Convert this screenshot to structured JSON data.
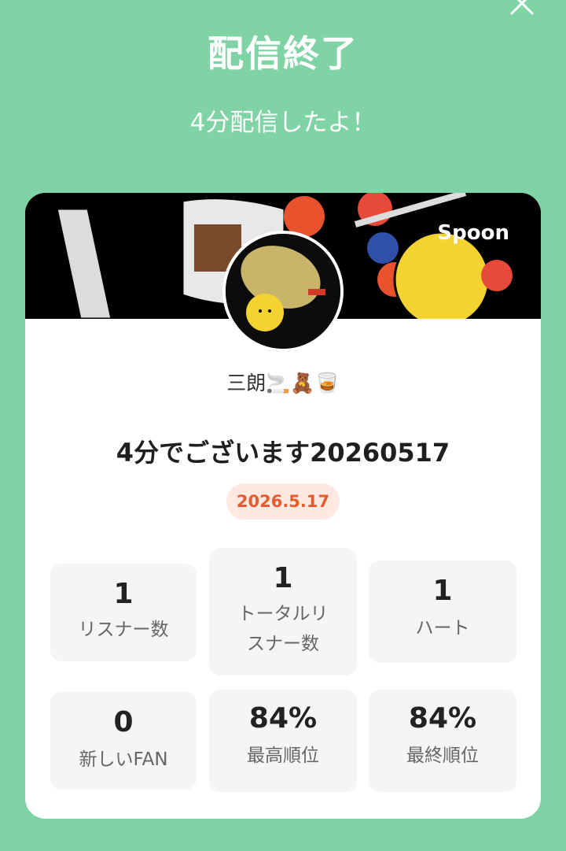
{
  "header": {
    "title": "配信終了",
    "subtitle": "4分配信したよ！"
  },
  "card": {
    "brand": "Spoon",
    "username": "三朗🚬🧸🥃",
    "stream_title": "4分でございます20260517",
    "date": "2026.5.17"
  },
  "stats": [
    {
      "value": "1",
      "label": "リスナー数"
    },
    {
      "value": "1",
      "label_lines": [
        "トータルリ",
        "スナー数"
      ]
    },
    {
      "value": "1",
      "label": "ハート"
    },
    {
      "value": "0",
      "label": "新しいFAN"
    },
    {
      "value": "84%",
      "label": "最高順位"
    },
    {
      "value": "84%",
      "label": "最終順位"
    }
  ],
  "colors": {
    "background": "#7fd3a4",
    "badge_text": "#e65a2c",
    "badge_bg": "#fde8e2"
  },
  "icons": {
    "close": "close-icon"
  }
}
